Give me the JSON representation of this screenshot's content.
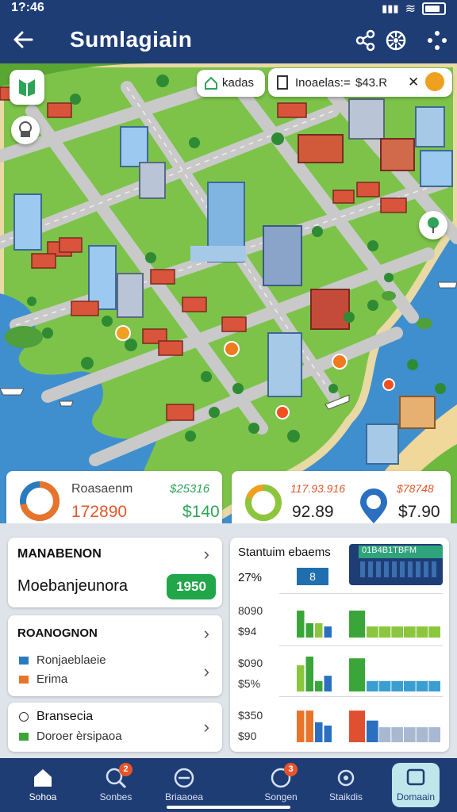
{
  "status": {
    "time": "1?:46"
  },
  "header": {
    "title": "Sumlagiain"
  },
  "map_chips": {
    "zone_label": "kadas",
    "search_label": "Inoaelas:=",
    "search_value": "$43.R"
  },
  "stats": {
    "left": {
      "title": "Roasaenm",
      "value_top": "$25316",
      "value_main": "172890",
      "value_right": "$140",
      "donut_fraction": 0.72
    },
    "right": {
      "value_top_left": "117.93.916",
      "value_top_right": "$78748",
      "value_main_left": "92.89",
      "value_main_right": "$7.90",
      "donut_fraction": 0.8
    }
  },
  "management": {
    "heading": "MANABENON",
    "subtitle": "Moebanjeunora",
    "button_label": "1950"
  },
  "resource": {
    "heading": "ROANOGNON",
    "items": [
      {
        "label": "Ronjaeblaeie",
        "color": "#2a7bbd"
      },
      {
        "label": "Erima",
        "color": "#e8742a"
      }
    ]
  },
  "branch": {
    "heading": "Bransecia",
    "subtitle": "Doroer èrsipaoa"
  },
  "stat_panel": {
    "title": "Stantuim ebaems",
    "row1": {
      "value": "27%",
      "tag": "8",
      "banner": "01B4B1TBFM"
    },
    "row2": {
      "top": "8090",
      "bottom": "$94"
    },
    "row3": {
      "top": "$090",
      "bottom": "$5%"
    },
    "row4": {
      "top": "$350",
      "bottom": "$90"
    }
  },
  "chart_data": [
    {
      "type": "bar",
      "values": [
        0.85,
        0.45,
        0.45,
        0.35
      ],
      "colors": [
        "#3aa63a",
        "#3aa63a",
        "#8cc63f",
        "#2a6fc0"
      ]
    },
    {
      "type": "bar",
      "values": [
        0.85,
        0.35,
        0.35,
        0.35,
        0.35,
        0.35,
        0.35
      ],
      "colors": [
        "#3aa63a",
        "#8cc63f",
        "#8cc63f",
        "#8cc63f",
        "#8cc63f",
        "#8cc63f",
        "#8cc63f"
      ]
    },
    {
      "type": "bar",
      "values": [
        0.75,
        1.0,
        0.3,
        0.45
      ],
      "colors": [
        "#8cc63f",
        "#3aa63a",
        "#3aa63a",
        "#2a6fc0"
      ]
    },
    {
      "type": "bar",
      "values": [
        0.95,
        0.3,
        0.3,
        0.3,
        0.3,
        0.3,
        0.3
      ],
      "colors": [
        "#3aa63a",
        "#3a9fd0",
        "#3a9fd0",
        "#3a9fd0",
        "#3a9fd0",
        "#3a9fd0",
        "#3a9fd0"
      ]
    },
    {
      "type": "bar",
      "values": [
        0.95,
        0.95,
        0.6,
        0.5
      ],
      "colors": [
        "#e8742a",
        "#e8742a",
        "#2a6fc0",
        "#2a6fc0"
      ]
    },
    {
      "type": "bar",
      "values": [
        0.95,
        0.65,
        0.45,
        0.45,
        0.45,
        0.45,
        0.45
      ],
      "colors": [
        "#e05030",
        "#2a6fc0",
        "#a8b8d0",
        "#a8b8d0",
        "#a8b8d0",
        "#a8b8d0",
        "#a8b8d0"
      ]
    }
  ],
  "nav": {
    "items": [
      {
        "label": "Sohoa"
      },
      {
        "label": "Sonbes",
        "badge": "2"
      },
      {
        "label": "Briaaoea"
      },
      {
        "label": "Songen",
        "badge": "3"
      },
      {
        "label": "Staikdis"
      },
      {
        "label": "Domaain"
      }
    ]
  },
  "colors": {
    "header": "#1f3d75",
    "water": "#3f8fcf",
    "grass": "#7dc34a",
    "road": "#c9c9c9",
    "accent_green": "#21a64a"
  }
}
